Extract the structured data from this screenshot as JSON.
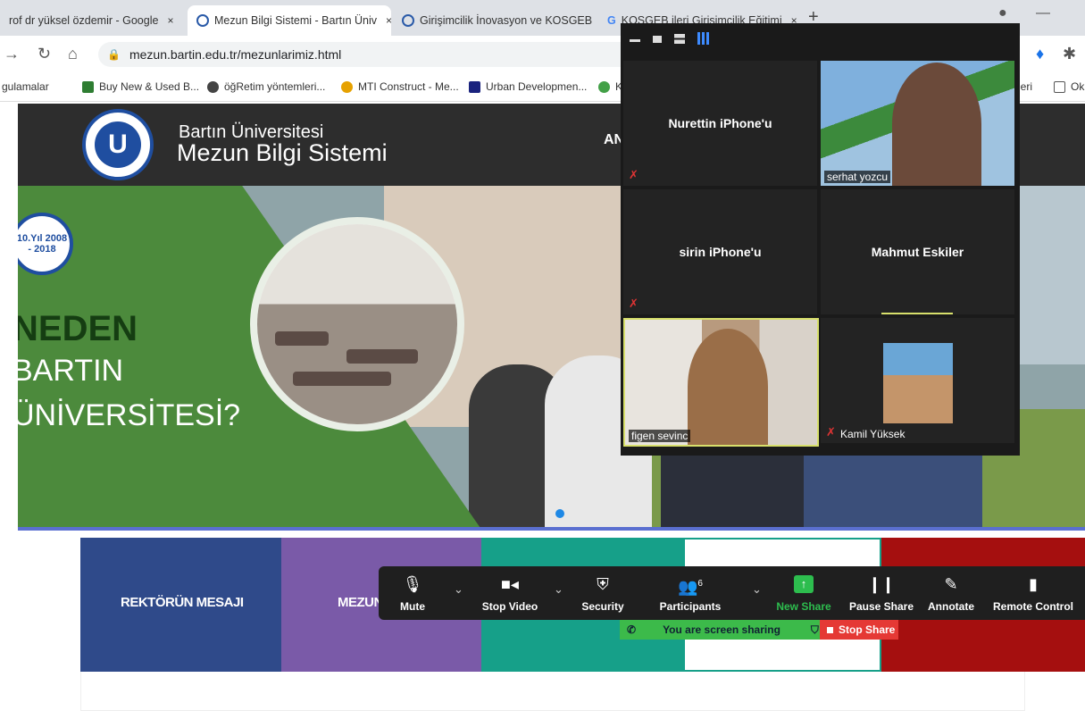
{
  "browser": {
    "tabs": [
      {
        "title": "rof dr yüksel özdemir - Google",
        "close": "×"
      },
      {
        "title": "Mezun Bilgi Sistemi - Bartın Üniv",
        "close": "×"
      },
      {
        "title": "Girişimcilik İnovasyon ve KOSGEB",
        "close": "×"
      },
      {
        "title": "KOSGEB ileri Girişimcilik Eğitimi",
        "close": "×"
      }
    ],
    "new_tab": "+",
    "minimize": "—",
    "url": "mezun.bartin.edu.tr/mezunlarimiz.html",
    "bookmarks": [
      {
        "label": "gulamalar",
        "icon_color": "#888888"
      },
      {
        "label": "Buy New & Used B...",
        "icon_color": "#2e7d32"
      },
      {
        "label": "öğRetim yöntemleri...",
        "icon_color": "#444444"
      },
      {
        "label": "MTI Construct - Me...",
        "icon_color": "#e6a100"
      },
      {
        "label": "Urban Developmen...",
        "icon_color": "#1a237e"
      },
      {
        "label": "K",
        "icon_color": "#43a047"
      }
    ],
    "bookmarks_right": [
      "leri",
      "Ok"
    ]
  },
  "site": {
    "uni_name": "Bartın Üniversitesi",
    "system_name": "Mezun Bilgi Sistemi",
    "nav_partial": "AN",
    "badge_text": "10.Yıl 2008 - 2018",
    "hero_line1": "NEDEN",
    "hero_line2": "BARTIN",
    "hero_line3": "ÜNİVERSİTESİ?",
    "tiles": [
      {
        "label": "REKTÖRÜN MESAJI",
        "color": "#2f4a8a"
      },
      {
        "label": "MEZUN",
        "color": "#7a5aa8"
      },
      {
        "label": "",
        "color": "#16a089"
      },
      {
        "label": "",
        "color": "#ffffff"
      },
      {
        "label": "",
        "color": "#a50f0f"
      }
    ]
  },
  "zoom": {
    "participants": [
      {
        "name": "Nurettin iPhone'u",
        "muted": true,
        "video": false
      },
      {
        "name": "serhat yozcu",
        "muted": false,
        "video": true
      },
      {
        "name": "sirin iPhone'u",
        "muted": true,
        "video": false
      },
      {
        "name": "Mahmut Eskiler",
        "muted": false,
        "video": false
      },
      {
        "name": "figen sevinc",
        "muted": false,
        "video": true,
        "active": true
      },
      {
        "name": "Kamil Yüksek",
        "muted": true,
        "video": true
      }
    ],
    "toolbar": {
      "mute": "Mute",
      "stop_video": "Stop Video",
      "security": "Security",
      "participants": "Participants",
      "participants_count": "6",
      "new_share": "New Share",
      "pause_share": "Pause Share",
      "annotate": "Annotate",
      "remote_control": "Remote Control"
    },
    "sharing_text": "You are screen sharing",
    "stop_share": "Stop Share"
  }
}
